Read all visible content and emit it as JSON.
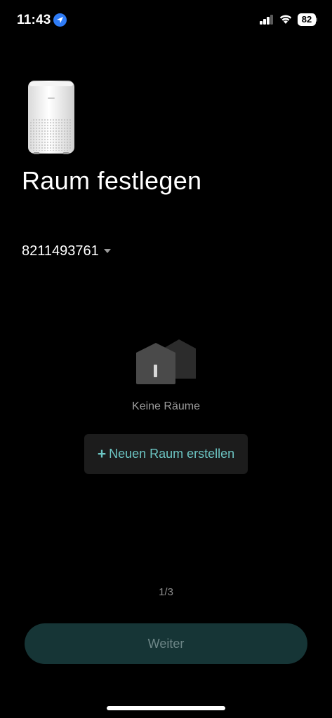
{
  "status_bar": {
    "time": "11:43",
    "battery": "82",
    "location_icon": "location-arrow-icon",
    "signal_icon": "cellular-signal-icon",
    "wifi_icon": "wifi-icon"
  },
  "device": {
    "image": "air-purifier-image"
  },
  "page": {
    "title": "Raum festlegen"
  },
  "home_selector": {
    "home_id": "8211493761",
    "icon": "caret-down-icon"
  },
  "empty_state": {
    "icon": "houses-icon",
    "text": "Keine Räume"
  },
  "create_room": {
    "plus": "+",
    "label": "Neuen Raum erstellen"
  },
  "pagination": {
    "indicator": "1/3"
  },
  "footer": {
    "next_label": "Weiter"
  },
  "colors": {
    "background": "#000000",
    "accent": "#6cc5c3",
    "next_button_bg": "#163536",
    "create_button_bg": "#1c1c1c"
  }
}
